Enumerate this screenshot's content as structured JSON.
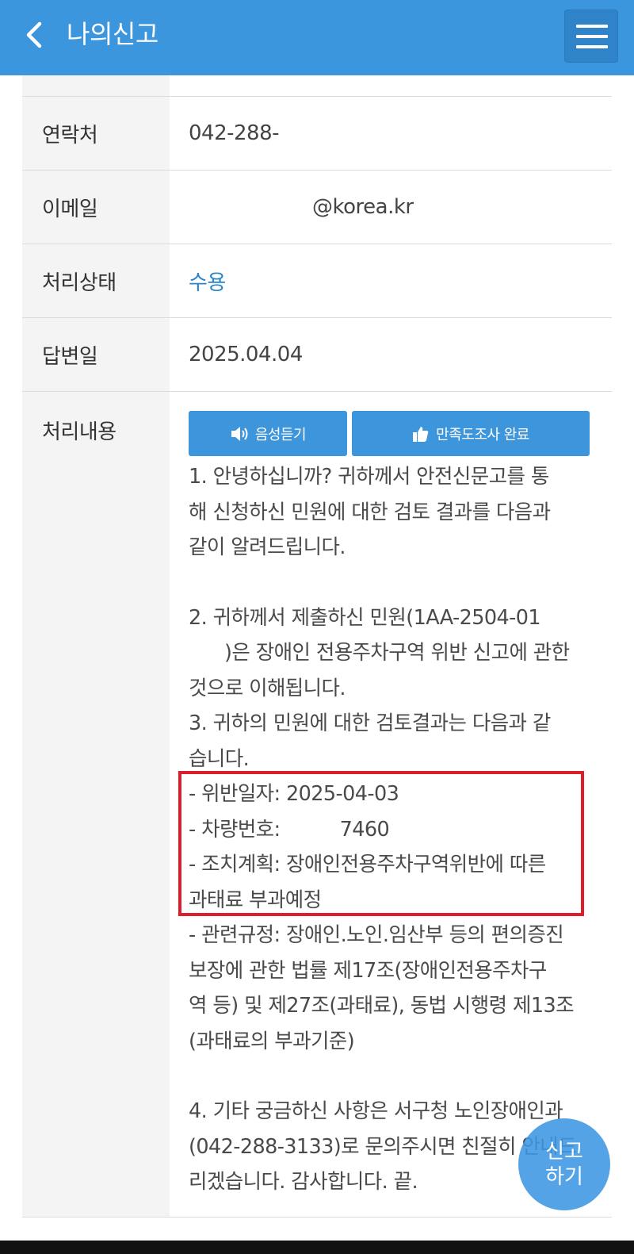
{
  "header": {
    "title": "나의신고"
  },
  "fields": {
    "contact": {
      "label": "연락처",
      "value": "042-288-"
    },
    "email": {
      "label": "이메일",
      "value": "@korea.kr"
    },
    "status": {
      "label": "처리상태",
      "value": "수용"
    },
    "answer_date": {
      "label": "답변일",
      "value": "2025.04.04"
    },
    "content": {
      "label": "처리내용"
    }
  },
  "buttons": {
    "listen": "음성듣기",
    "survey": "만족도조사 완료"
  },
  "response": {
    "p1": [
      "1. 안녕하십니까? 귀하께서 안전신문고를 통",
      "해 신청하신 민원에 대한 검토 결과를 다음과",
      "같이 알려드립니다."
    ],
    "p2": [
      "2. 귀하께서 제출하신 민원(1AA-2504-01",
      "      )은 장애인 전용주차구역 위반 신고에 관한",
      "것으로 이해됩니다."
    ],
    "p3": [
      "3. 귀하의 민원에 대한 검토결과는 다음과 같",
      "습니다."
    ],
    "details": [
      "- 위반일자: 2025-04-03",
      "- 차량번호:          7460",
      "- 조치계획: 장애인전용주차구역위반에 따른",
      "과태료 부과예정"
    ],
    "rules": [
      "- 관련규정: 장애인.노인.임산부 등의 편의증진",
      "보장에 관한 법률 제17조(장애인전용주차구",
      "역 등) 및 제27조(과태료), 동법 시행령 제13조",
      "(과태료의 부과기준)"
    ],
    "p4": [
      "4. 기타 궁금하신 사항은 서구청 노인장애인과",
      "(042-288-3133)로 문의주시면 친절히 안내드",
      "리겠습니다. 감사합니다. 끝."
    ]
  },
  "fab": {
    "line1": "신고",
    "line2": "하기"
  },
  "colors": {
    "header": "#3b96dd",
    "button": "#3d95db",
    "status": "#2b86c9",
    "highlight": "#dc1e2b"
  }
}
